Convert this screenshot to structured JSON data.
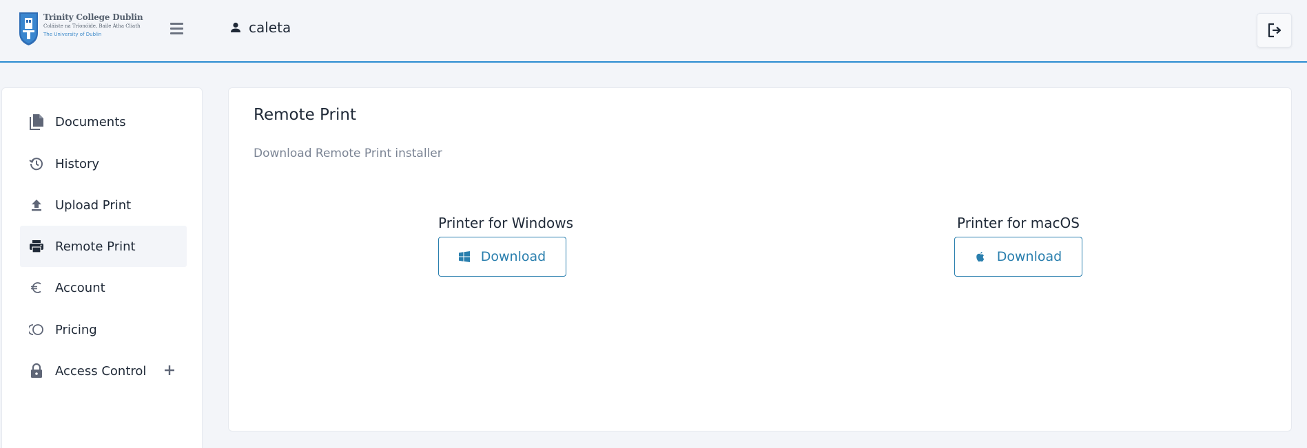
{
  "header": {
    "logo": {
      "line1": "Trinity College Dublin",
      "line2": "Coláiste na Tríonóide, Baile Átha Cliath",
      "line3": "The University of Dublin"
    },
    "username": "caleta",
    "menu_icon": "hamburger-icon",
    "logout_icon": "logout-icon"
  },
  "sidebar": {
    "items": [
      {
        "label": "Documents",
        "icon": "documents-icon"
      },
      {
        "label": "History",
        "icon": "history-icon"
      },
      {
        "label": "Upload Print",
        "icon": "upload-icon"
      },
      {
        "label": "Remote Print",
        "icon": "printer-icon",
        "active": true
      },
      {
        "label": "Account",
        "icon": "euro-icon"
      },
      {
        "label": "Pricing",
        "icon": "pricing-icon"
      },
      {
        "label": "Access Control",
        "icon": "lock-icon",
        "expand_icon": "plus-icon"
      }
    ]
  },
  "main": {
    "title": "Remote Print",
    "subtitle": "Download Remote Print installer",
    "downloads": [
      {
        "title": "Printer for Windows",
        "button_label": "Download",
        "icon": "windows-icon"
      },
      {
        "title": "Printer for macOS",
        "button_label": "Download",
        "icon": "apple-icon"
      }
    ]
  },
  "colors": {
    "accent": "#2a7fae",
    "header_border": "#2a8bd0",
    "background": "#f3f5f9",
    "icon_gray": "#5f6677"
  }
}
